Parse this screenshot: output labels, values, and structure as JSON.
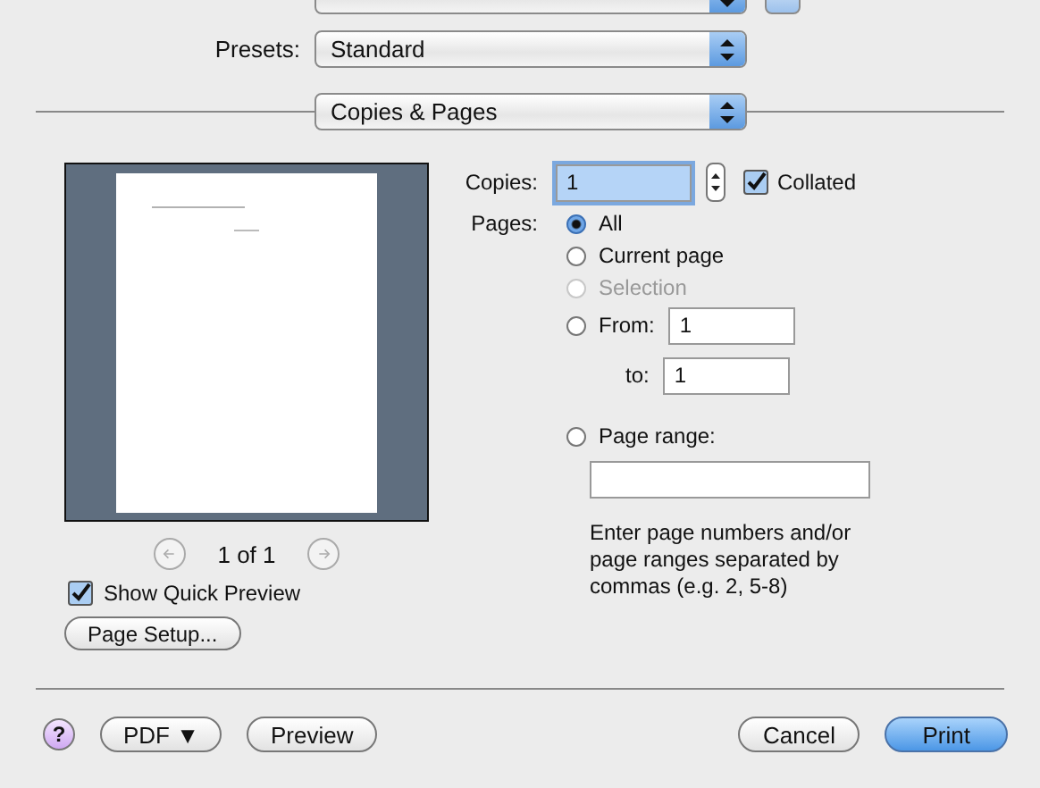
{
  "presets": {
    "label": "Presets:",
    "value": "Standard"
  },
  "panel_popup": {
    "value": "Copies & Pages"
  },
  "preview": {
    "page_counter": "1 of 1",
    "quick_preview": {
      "label": "Show Quick Preview",
      "checked": true
    },
    "page_setup_button": "Page Setup..."
  },
  "copies": {
    "label": "Copies:",
    "value": "1",
    "focused": true,
    "collated": {
      "label": "Collated",
      "checked": true
    }
  },
  "pages": {
    "label": "Pages:",
    "options": [
      {
        "kind": "plain",
        "label": "All",
        "selected": true,
        "disabled": false
      },
      {
        "kind": "plain",
        "label": "Current page",
        "selected": false,
        "disabled": false
      },
      {
        "kind": "plain",
        "label": "Selection",
        "selected": false,
        "disabled": true
      },
      {
        "kind": "from",
        "label": "From:",
        "value": "1",
        "to_label": "to:",
        "to_value": "1",
        "selected": false,
        "disabled": false
      },
      {
        "kind": "range",
        "label": "Page range:",
        "hint": "Enter page numbers and/or page ranges separated by commas (e.g. 2, 5-8)",
        "selected": false,
        "disabled": false
      }
    ]
  },
  "buttons": [
    {
      "kind": "help",
      "label": "?"
    },
    {
      "kind": "normal",
      "label": "PDF ▼"
    },
    {
      "kind": "normal",
      "label": "Preview"
    },
    {
      "kind": "spacer"
    },
    {
      "kind": "normal",
      "label": "Cancel"
    },
    {
      "kind": "default",
      "label": "Print"
    }
  ]
}
